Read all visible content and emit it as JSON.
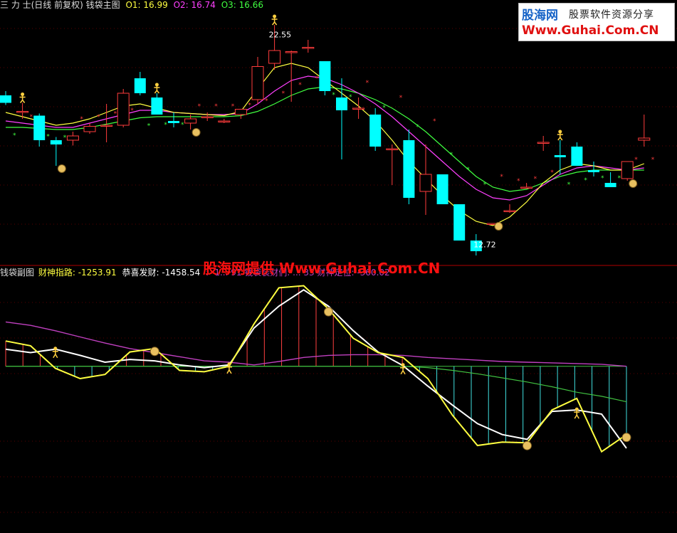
{
  "main_header": {
    "title": "三 力 士(日线 前复权) 钱袋主图",
    "o1": "O1: 16.99",
    "o2": "O2: 16.74",
    "o3": "O3: 16.66"
  },
  "sub_header": {
    "title": "钱袋副图",
    "item1": "财神指路: -1253.91",
    "item2": "恭喜发财: -1458.54",
    "item3": ": -1... 91 钱袋装财们: ... 33 财神定位: -360.02"
  },
  "logo": {
    "name": "股海网",
    "slogan": "股票软件资源分享",
    "url": "Www.Guhai.Com.CN"
  },
  "watermark": "股海网提供 Www.Guhai.Com.CN",
  "colors": {
    "up": "#ff3c3c",
    "down": "#00ffff",
    "ma_yellow": "#ffff40",
    "ma_magenta": "#ff40ff",
    "ma_green": "#40ff40",
    "white_line": "#ffffff",
    "purple_line": "#c040c0",
    "green_line": "#40c040"
  },
  "chart_data": [
    {
      "type": "candlestick",
      "title": "钱袋主图",
      "price_range": [
        12.0,
        23.7
      ],
      "high_label": "22.55",
      "low_label": "12.72",
      "candles": [
        {
          "o": 19.7,
          "h": 19.9,
          "l": 19.25,
          "c": 19.35
        },
        {
          "o": 18.9,
          "h": 19.35,
          "l": 18.6,
          "c": 18.95
        },
        {
          "o": 18.75,
          "h": 18.85,
          "l": 17.3,
          "c": 17.6
        },
        {
          "o": 17.6,
          "h": 17.75,
          "l": 16.4,
          "c": 17.4
        },
        {
          "o": 17.6,
          "h": 18.0,
          "l": 17.35,
          "c": 17.8
        },
        {
          "o": 18.0,
          "h": 18.4,
          "l": 17.9,
          "c": 18.25
        },
        {
          "o": 18.3,
          "h": 19.3,
          "l": 17.5,
          "c": 18.3
        },
        {
          "o": 18.3,
          "h": 20.0,
          "l": 18.2,
          "c": 19.8
        },
        {
          "o": 20.5,
          "h": 20.8,
          "l": 19.7,
          "c": 19.8
        },
        {
          "o": 19.6,
          "h": 19.8,
          "l": 18.8,
          "c": 18.8
        },
        {
          "o": 18.5,
          "h": 18.9,
          "l": 18.2,
          "c": 18.4
        },
        {
          "o": 18.4,
          "h": 18.8,
          "l": 18.1,
          "c": 18.6
        },
        {
          "o": 18.7,
          "h": 18.9,
          "l": 18.5,
          "c": 18.7
        },
        {
          "o": 18.5,
          "h": 18.6,
          "l": 18.4,
          "c": 18.5
        },
        {
          "o": 18.8,
          "h": 19.0,
          "l": 18.6,
          "c": 19.05
        },
        {
          "o": 19.5,
          "h": 21.5,
          "l": 19.3,
          "c": 21.05
        },
        {
          "o": 21.2,
          "h": 23.0,
          "l": 20.9,
          "c": 21.8
        },
        {
          "o": 21.7,
          "h": 21.8,
          "l": 19.4,
          "c": 21.75
        },
        {
          "o": 21.9,
          "h": 22.3,
          "l": 21.7,
          "c": 21.95
        },
        {
          "o": 21.3,
          "h": 20.5,
          "l": 19.7,
          "c": 19.9
        },
        {
          "o": 19.6,
          "h": 20.5,
          "l": 16.7,
          "c": 19.0
        },
        {
          "o": 19.1,
          "h": 19.6,
          "l": 18.6,
          "c": 19.1
        },
        {
          "o": 18.8,
          "h": 19.1,
          "l": 17.1,
          "c": 17.3
        },
        {
          "o": 17.2,
          "h": 17.4,
          "l": 15.5,
          "c": 17.2
        },
        {
          "o": 17.6,
          "h": 18.1,
          "l": 14.6,
          "c": 14.9
        },
        {
          "o": 15.2,
          "h": 17.4,
          "l": 14.1,
          "c": 16.0
        },
        {
          "o": 16.0,
          "h": 16.0,
          "l": 14.7,
          "c": 14.6
        },
        {
          "o": 14.6,
          "h": 14.6,
          "l": 13.6,
          "c": 12.9
        },
        {
          "o": 12.9,
          "h": 13.2,
          "l": 12.2,
          "c": 12.4
        },
        {
          "o": 13.7,
          "h": 13.7,
          "l": 13.7,
          "c": 13.7
        },
        {
          "o": 14.3,
          "h": 14.6,
          "l": 14.2,
          "c": 14.3
        },
        {
          "o": 15.4,
          "h": 15.6,
          "l": 15.4,
          "c": 15.4
        },
        {
          "o": 17.5,
          "h": 17.8,
          "l": 17.1,
          "c": 17.5
        },
        {
          "o": 16.9,
          "h": 17.6,
          "l": 16.0,
          "c": 16.8
        },
        {
          "o": 17.3,
          "h": 17.5,
          "l": 16.4,
          "c": 16.4
        },
        {
          "o": 16.2,
          "h": 16.6,
          "l": 15.9,
          "c": 16.1
        },
        {
          "o": 15.6,
          "h": 16.1,
          "l": 15.4,
          "c": 15.4
        },
        {
          "o": 15.8,
          "h": 16.5,
          "l": 15.7,
          "c": 16.6
        },
        {
          "o": 17.6,
          "h": 18.8,
          "l": 17.3,
          "c": 17.7
        }
      ],
      "ma_yellow": [
        18.9,
        18.7,
        18.5,
        18.3,
        18.4,
        18.6,
        18.9,
        19.2,
        19.3,
        19.1,
        18.9,
        18.85,
        18.8,
        18.75,
        18.95,
        20.0,
        21.0,
        21.2,
        21.0,
        20.4,
        19.8,
        19.2,
        18.5,
        17.6,
        16.6,
        15.8,
        15.0,
        14.3,
        13.8,
        13.6,
        14.0,
        14.7,
        15.6,
        16.2,
        16.5,
        16.4,
        16.2,
        16.2,
        16.5
      ],
      "ma_magenta": [
        18.5,
        18.4,
        18.3,
        18.2,
        18.2,
        18.4,
        18.6,
        18.8,
        19.0,
        19.0,
        18.9,
        18.85,
        18.8,
        18.8,
        18.85,
        19.3,
        19.9,
        20.4,
        20.6,
        20.5,
        20.2,
        19.8,
        19.3,
        18.7,
        18.0,
        17.3,
        16.6,
        15.9,
        15.3,
        14.9,
        14.8,
        15.0,
        15.5,
        16.0,
        16.3,
        16.4,
        16.3,
        16.2,
        16.3
      ],
      "ma_green": [
        18.2,
        18.2,
        18.15,
        18.1,
        18.1,
        18.2,
        18.35,
        18.5,
        18.65,
        18.7,
        18.7,
        18.7,
        18.7,
        18.7,
        18.75,
        18.95,
        19.3,
        19.7,
        20.0,
        20.1,
        20.0,
        19.8,
        19.5,
        19.1,
        18.6,
        18.0,
        17.3,
        16.6,
        15.9,
        15.4,
        15.2,
        15.3,
        15.6,
        15.9,
        16.1,
        16.2,
        16.2,
        16.2,
        16.2
      ]
    },
    {
      "type": "line",
      "title": "钱袋副图",
      "y_range": [
        -2400,
        1300
      ],
      "zero": 0,
      "yellow": [
        370,
        300,
        -30,
        -180,
        -120,
        210,
        260,
        -60,
        -80,
        0,
        620,
        1150,
        1180,
        840,
        410,
        200,
        130,
        -180,
        -720,
        -1160,
        -1110,
        -1120,
        -640,
        -470,
        -1250,
        -1000
      ],
      "white": [
        250,
        200,
        250,
        160,
        60,
        100,
        80,
        20,
        -20,
        20,
        560,
        880,
        1120,
        880,
        520,
        210,
        10,
        -290,
        -570,
        -840,
        -1000,
        -1070,
        -660,
        -640,
        -700,
        -1200
      ],
      "purple": [
        650,
        600,
        520,
        430,
        340,
        260,
        200,
        140,
        80,
        60,
        20,
        70,
        130,
        160,
        170,
        170,
        160,
        130,
        110,
        90,
        70,
        60,
        50,
        40,
        30,
        0
      ],
      "green": [
        0,
        0,
        0,
        0,
        0,
        0,
        0,
        0,
        0,
        0,
        0,
        0,
        0,
        0,
        0,
        0,
        0,
        -20,
        -60,
        -110,
        -170,
        -230,
        -300,
        -380,
        -440,
        -520
      ]
    }
  ]
}
